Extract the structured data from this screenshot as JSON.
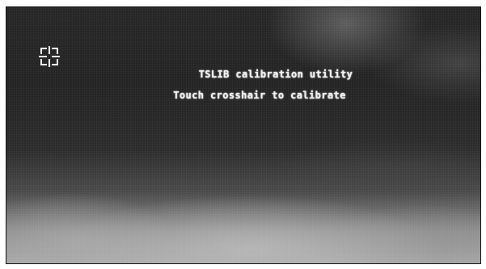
{
  "screen": {
    "title": "TSLIB calibration utility",
    "instruction": "Touch crosshair to calibrate"
  },
  "crosshair": {
    "icon": "crosshair-icon",
    "color": "#ffffff"
  }
}
